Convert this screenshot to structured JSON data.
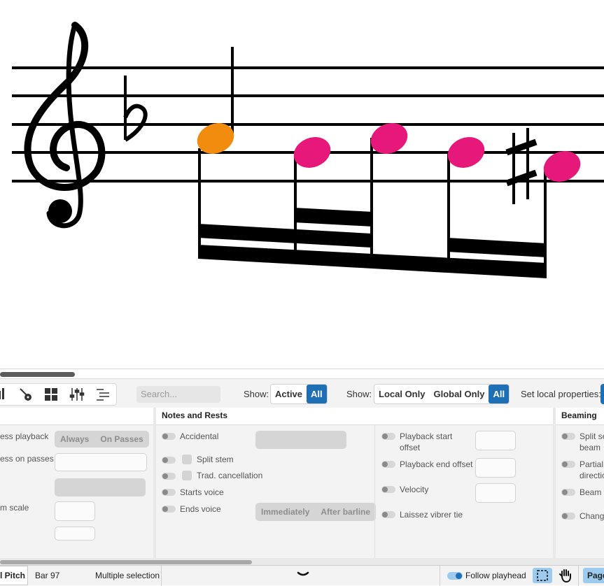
{
  "score": {
    "accent_selected": "#f28c0f",
    "accent_notes": "#e6197a"
  },
  "toolbar": {
    "search_placeholder": "Search...",
    "show_label_1": "Show:",
    "show_active": "Active",
    "show_all_1": "All",
    "show_label_2": "Show:",
    "local_only": "Local Only",
    "global_only": "Global Only",
    "show_all_2": "All",
    "set_local_label": "Set local properties:",
    "icons": [
      "bar-chart-icon",
      "guitar-icon",
      "grid-icon",
      "mixer-icon",
      "list-indent-icon"
    ]
  },
  "panels": {
    "left": {
      "rows": [
        "ess playback",
        "ess on passes",
        "m scale"
      ],
      "always": "Always",
      "on_passes": "On Passes"
    },
    "notes_rests": {
      "title": "Notes and Rests",
      "accidental": "Accidental",
      "split_stem": "Split stem",
      "trad_cancellation": "Trad. cancellation",
      "starts_voice": "Starts voice",
      "ends_voice": "Ends voice",
      "immediately": "Immediately",
      "after_barline": "After barline",
      "playback_start_1": "Playback start",
      "playback_start_2": "offset",
      "playback_end": "Playback end offset",
      "velocity": "Velocity",
      "laissez": "Laissez vibrer tie"
    },
    "beaming": {
      "title": "Beaming",
      "split_1": "Split se",
      "split_2": "beam",
      "partial_1": "Partial",
      "partial_2": "directio",
      "beam_c": "Beam c",
      "change": "Change"
    }
  },
  "status": {
    "pitch": "l Pitch",
    "bar": "Bar 97",
    "selection": "Multiple selection",
    "follow": "Follow playhead",
    "page": "Page"
  },
  "colors": {
    "accent_blue": "#1e6fb4",
    "light_blue": "#9ccbed"
  }
}
